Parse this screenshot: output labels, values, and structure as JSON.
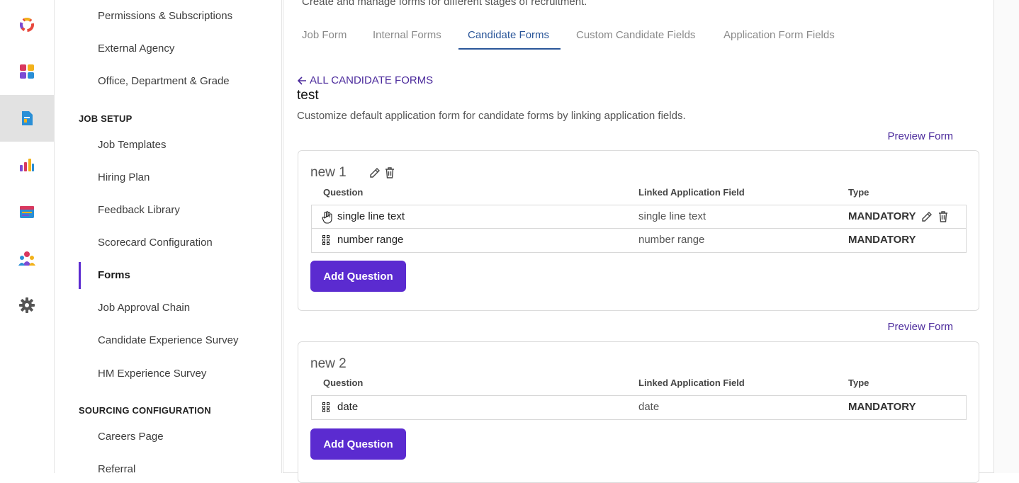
{
  "rail": {
    "items": [
      {
        "name": "logo-icon",
        "color": "#e8473c"
      },
      {
        "name": "dashboard-icon",
        "color": "#d9385e"
      },
      {
        "name": "document-icon",
        "color": "#2a8fd6"
      },
      {
        "name": "analytics-icon",
        "color": "#7b4bd4"
      },
      {
        "name": "calendar-icon",
        "color": "#2a8fd6"
      },
      {
        "name": "people-icon",
        "color": "#d9385e"
      },
      {
        "name": "settings-icon",
        "color": "#555555"
      }
    ]
  },
  "sidebar": {
    "top_items": [
      "Permissions & Subscriptions",
      "External Agency",
      "Office, Department & Grade"
    ],
    "job_setup_heading": "JOB SETUP",
    "job_setup_items": [
      "Job Templates",
      "Hiring Plan",
      "Feedback Library",
      "Scorecard Configuration",
      "Forms",
      "Job Approval Chain",
      "Candidate Experience Survey",
      "HM Experience Survey"
    ],
    "sourcing_heading": "SOURCING CONFIGURATION",
    "sourcing_items": [
      "Careers Page",
      "Referral"
    ]
  },
  "main": {
    "page_subtitle": "Create and manage forms for different stages of recruitment.",
    "tabs": [
      {
        "label": "Job Form"
      },
      {
        "label": "Internal Forms"
      },
      {
        "label": "Candidate Forms"
      },
      {
        "label": "Custom Candidate Fields"
      },
      {
        "label": "Application Form Fields"
      }
    ],
    "active_tab": "Candidate Forms",
    "back_link": "ALL CANDIDATE FORMS",
    "form_title": "test",
    "form_description": "Customize default application form for candidate forms by linking application fields.",
    "preview_label": "Preview Form",
    "columns": {
      "question": "Question",
      "linked": "Linked Application Field",
      "type": "Type"
    },
    "add_question_label": "Add Question",
    "sections": [
      {
        "title": "new 1",
        "questions": [
          {
            "question": "single line text",
            "linked": "single line text",
            "type": "MANDATORY"
          },
          {
            "question": "number range",
            "linked": "number range",
            "type": "MANDATORY"
          }
        ]
      },
      {
        "title": "new 2",
        "questions": [
          {
            "question": "date",
            "linked": "date",
            "type": "MANDATORY"
          }
        ]
      }
    ]
  },
  "colors": {
    "accent": "#5b2bd0",
    "active_tab": "#2a5699",
    "link": "#4b2a9c"
  }
}
